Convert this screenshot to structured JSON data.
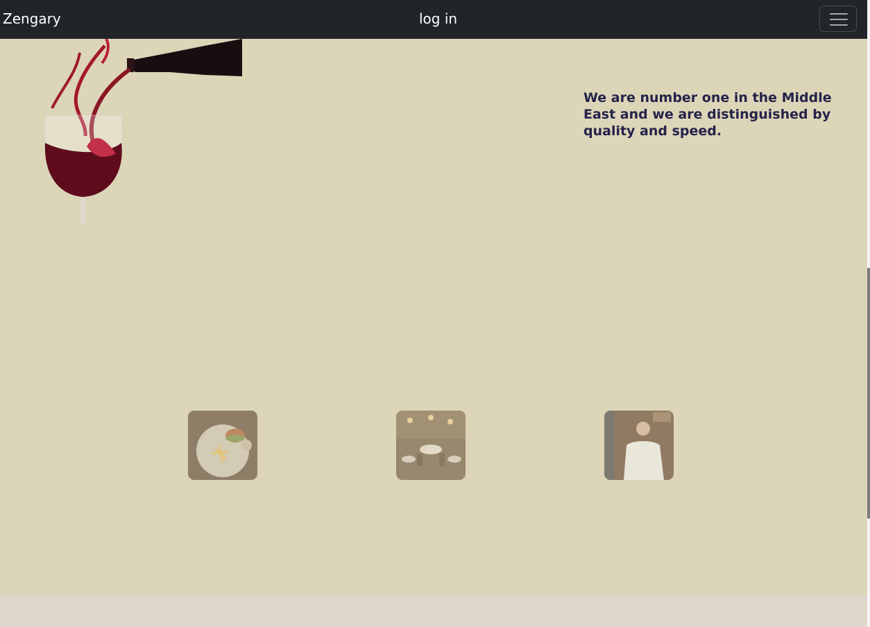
{
  "navbar": {
    "brand": "Zengary",
    "login_label": "log in",
    "toggler_icon": "hamburger-menu-icon"
  },
  "hero": {
    "tagline": "We are number one in the Middle East and we are distinguished by quality and speed.",
    "image": "wine-pouring-into-glass"
  },
  "gallery": {
    "items": [
      {
        "image": "burger-and-fries-plate"
      },
      {
        "image": "restaurant-dining-room"
      },
      {
        "image": "chef-in-white-jacket"
      }
    ]
  },
  "colors": {
    "navbar_bg": "#212529",
    "page_bg": "#ddd5b8",
    "tagline_text": "#23234a",
    "footer_band": "#ded7cc"
  }
}
